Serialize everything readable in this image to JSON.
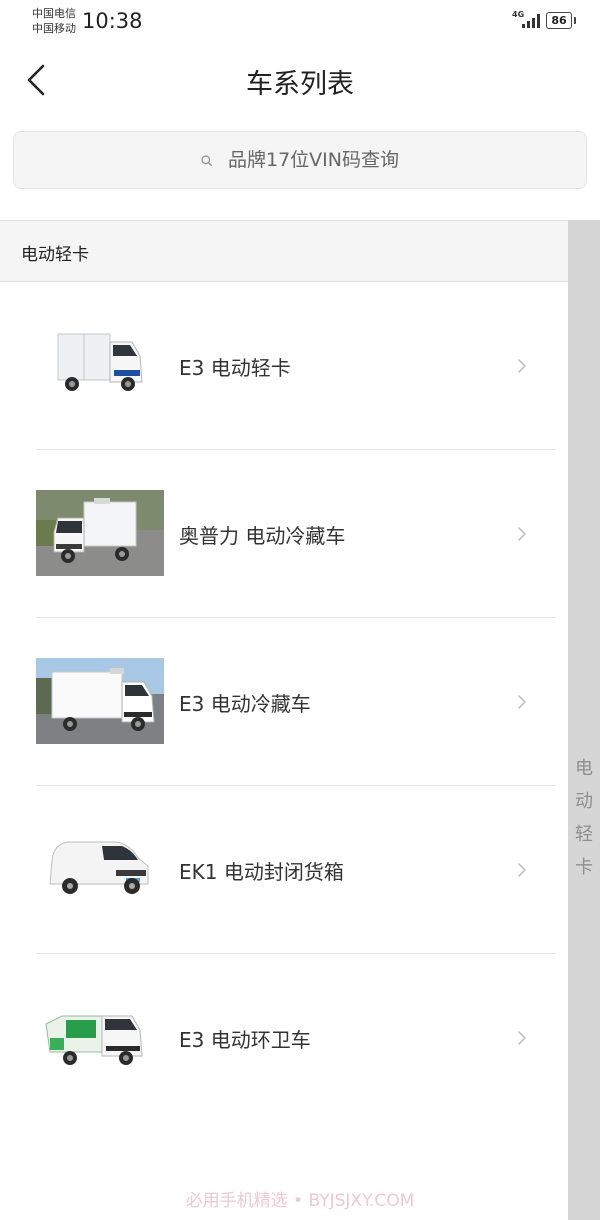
{
  "status_bar": {
    "carrier_1": "中国电信",
    "carrier_2": "中国移动",
    "time": "10:38",
    "network": "4G",
    "battery": "86"
  },
  "nav": {
    "title": "车系列表",
    "back_icon": "chevron-left-icon"
  },
  "search": {
    "placeholder": "品牌17位VIN码查询",
    "icon": "search-icon"
  },
  "section": {
    "title": "电动轻卡"
  },
  "vehicles": [
    {
      "name": "E3 电动轻卡",
      "image": "box-truck-photo"
    },
    {
      "name": "奥普力 电动冷藏车",
      "image": "refrigerated-truck-photo"
    },
    {
      "name": "E3 电动冷藏车",
      "image": "refrigerated-truck-photo"
    },
    {
      "name": "EK1 电动封闭货箱",
      "image": "cargo-van-photo"
    },
    {
      "name": "E3 电动环卫车",
      "image": "sanitation-truck-photo"
    }
  ],
  "index_bar": {
    "letters": [
      "电",
      "动",
      "轻",
      "卡"
    ]
  },
  "watermark": "必用手机精选 • BYJSJXY.COM",
  "colors": {
    "section_bg": "#f5f5f5",
    "index_bar_bg": "#d6d6d6",
    "accent_truck": "#2a9d4a"
  }
}
